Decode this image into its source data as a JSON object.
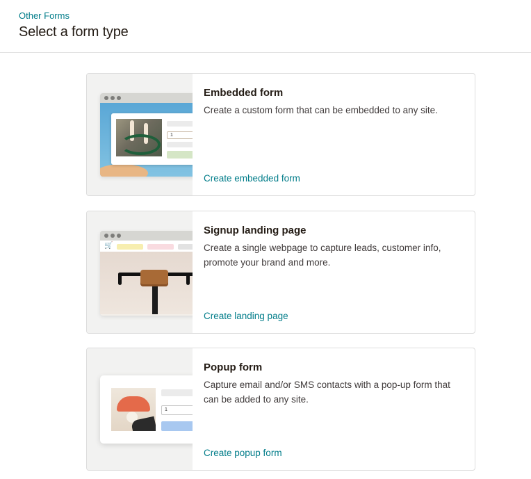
{
  "header": {
    "breadcrumb": "Other Forms",
    "title": "Select a form type"
  },
  "cards": [
    {
      "title": "Embedded form",
      "description": "Create a custom form that can be embedded to any site.",
      "link": "Create embedded form",
      "input_value": "1"
    },
    {
      "title": "Signup landing page",
      "description": "Create a single webpage to capture leads, customer info, promote your brand and more.",
      "link": "Create landing page"
    },
    {
      "title": "Popup form",
      "description": "Capture email and/or SMS contacts with a pop-up form that can be added to any site.",
      "link": "Create popup form",
      "input_value": "1"
    }
  ],
  "colors": {
    "link": "#007c89",
    "text": "#241c15",
    "border": "#dcdcdc"
  },
  "icons": {
    "cart": "shopping-cart-icon"
  }
}
